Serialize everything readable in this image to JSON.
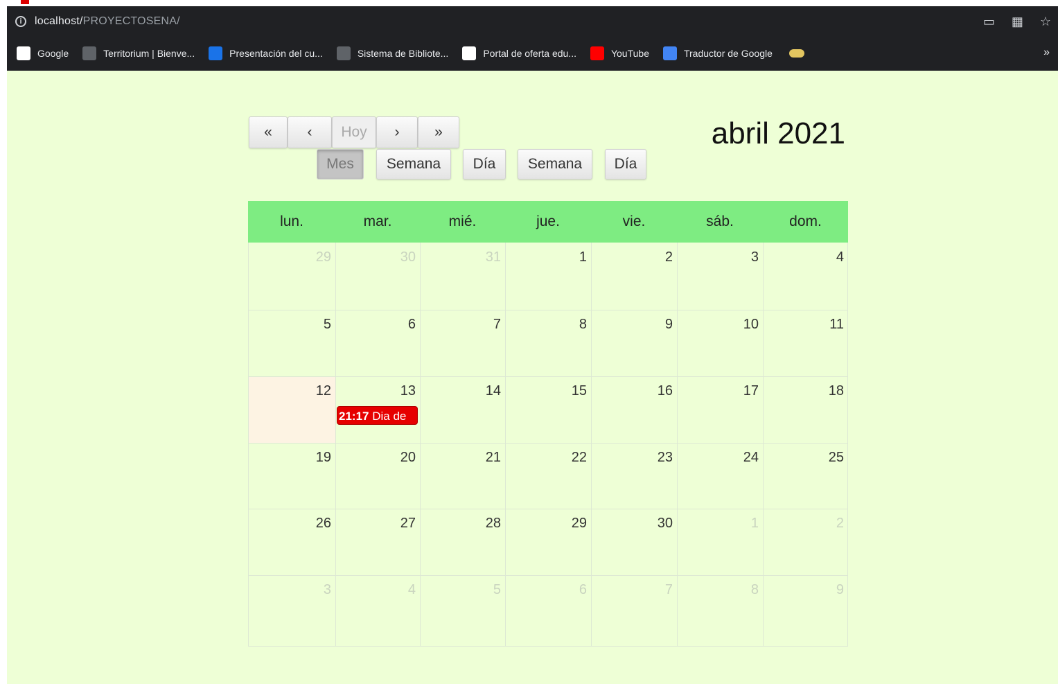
{
  "browser": {
    "url_host": "localhost/",
    "url_path": "PROYECTOSENA/",
    "bookmarks": [
      {
        "label": "Google",
        "icon": "google-icon",
        "color": "#ffffff"
      },
      {
        "label": "Territorium | Bienve...",
        "icon": "territorium-icon",
        "color": "#5f6368"
      },
      {
        "label": "Presentación del cu...",
        "icon": "presentation-icon",
        "color": "#1a73e8"
      },
      {
        "label": "Sistema de Bibliote...",
        "icon": "library-icon",
        "color": "#5f6368"
      },
      {
        "label": "Portal de oferta edu...",
        "icon": "sena-icon",
        "color": "#ffffff"
      },
      {
        "label": "YouTube",
        "icon": "youtube-icon",
        "color": "#ff0000"
      },
      {
        "label": "Traductor de Google",
        "icon": "translate-icon",
        "color": "#4285f4"
      }
    ],
    "more": "»"
  },
  "toolbar": {
    "prev_year": "«",
    "prev": "‹",
    "today": "Hoy",
    "next": "›",
    "next_year": "»",
    "views": [
      "Mes",
      "Semana",
      "Día",
      "Semana",
      "Día"
    ],
    "active_view": "Mes"
  },
  "title": "abril 2021",
  "colors": {
    "page_bg": "#eeffd6",
    "header_bg": "#7eec82",
    "today_bg": "#fdf3e3",
    "event_bg": "#e60000"
  },
  "calendar": {
    "weekdays": [
      "lun.",
      "mar.",
      "mié.",
      "jue.",
      "vie.",
      "sáb.",
      "dom."
    ],
    "weeks": [
      [
        {
          "n": "29",
          "other": true
        },
        {
          "n": "30",
          "other": true
        },
        {
          "n": "31",
          "other": true
        },
        {
          "n": "1"
        },
        {
          "n": "2"
        },
        {
          "n": "3"
        },
        {
          "n": "4"
        }
      ],
      [
        {
          "n": "5"
        },
        {
          "n": "6"
        },
        {
          "n": "7"
        },
        {
          "n": "8"
        },
        {
          "n": "9"
        },
        {
          "n": "10"
        },
        {
          "n": "11"
        }
      ],
      [
        {
          "n": "12",
          "today": true
        },
        {
          "n": "13"
        },
        {
          "n": "14"
        },
        {
          "n": "15"
        },
        {
          "n": "16"
        },
        {
          "n": "17"
        },
        {
          "n": "18"
        }
      ],
      [
        {
          "n": "19"
        },
        {
          "n": "20"
        },
        {
          "n": "21"
        },
        {
          "n": "22"
        },
        {
          "n": "23"
        },
        {
          "n": "24"
        },
        {
          "n": "25"
        }
      ],
      [
        {
          "n": "26"
        },
        {
          "n": "27"
        },
        {
          "n": "28"
        },
        {
          "n": "29"
        },
        {
          "n": "30"
        },
        {
          "n": "1",
          "other": true
        },
        {
          "n": "2",
          "other": true
        }
      ],
      [
        {
          "n": "3",
          "other": true
        },
        {
          "n": "4",
          "other": true
        },
        {
          "n": "5",
          "other": true
        },
        {
          "n": "6",
          "other": true
        },
        {
          "n": "7",
          "other": true
        },
        {
          "n": "8",
          "other": true
        },
        {
          "n": "9",
          "other": true
        }
      ]
    ],
    "event": {
      "time": "21:17",
      "title": "Dia de",
      "day": "13"
    }
  }
}
